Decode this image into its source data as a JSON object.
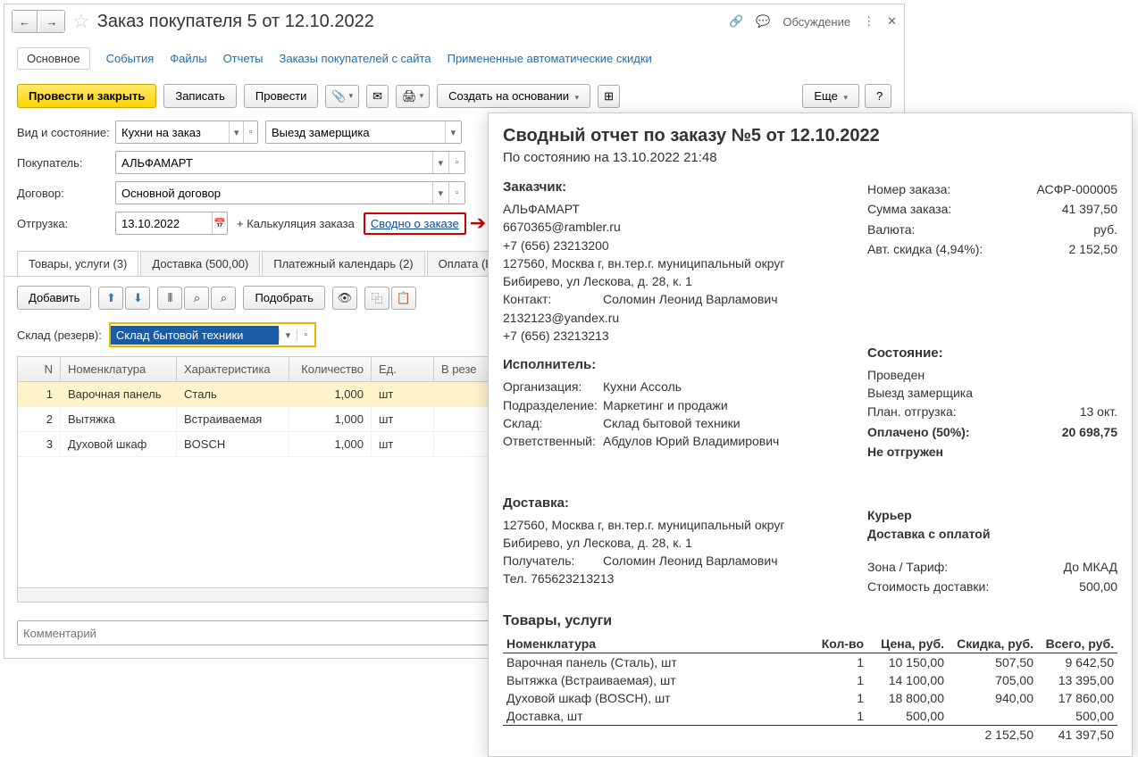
{
  "title": "Заказ покупателя 5 от 12.10.2022",
  "discuss": "Обсуждение",
  "tabs": [
    "Основное",
    "События",
    "Файлы",
    "Отчеты",
    "Заказы покупателей с сайта",
    "Примененные автоматические скидки"
  ],
  "toolbar": {
    "post_close": "Провести и закрыть",
    "save": "Записать",
    "post": "Провести",
    "create_based": "Создать на основании",
    "more": "Еще"
  },
  "form": {
    "type_label": "Вид и состояние:",
    "type_value": "Кухни на заказ",
    "state_value": "Выезд замерщика",
    "buyer_label": "Покупатель:",
    "buyer_value": "АЛЬФАМАРТ",
    "contract_label": "Договор:",
    "contract_value": "Основной договор",
    "ship_label": "Отгрузка:",
    "ship_date": "13.10.2022",
    "calc": "+ Калькуляция заказа",
    "summary": "Сводно о заказе"
  },
  "tabs2": [
    "Товары, услуги (3)",
    "Доставка (500,00)",
    "Платежный календарь (2)",
    "Оплата (Вруч"
  ],
  "tabletb": {
    "add": "Добавить",
    "pick": "Подобрать"
  },
  "wh": {
    "label": "Склад (резерв):",
    "value": "Склад бытовой техники"
  },
  "grid": {
    "head": [
      "N",
      "Номенклатура",
      "Характеристика",
      "Количество",
      "Ед.",
      "В резе"
    ],
    "rows": [
      {
        "n": "1",
        "nom": "Варочная панель",
        "char": "Сталь",
        "qty": "1,000",
        "unit": "шт"
      },
      {
        "n": "2",
        "nom": "Вытяжка",
        "char": "Встраиваемая",
        "qty": "1,000",
        "unit": "шт"
      },
      {
        "n": "3",
        "nom": "Духовой шкаф",
        "char": "BOSCH",
        "qty": "1,000",
        "unit": "шт"
      }
    ]
  },
  "comment_ph": "Комментарий",
  "report": {
    "title": "Сводный отчет по заказу №5 от 12.10.2022",
    "sub": "По состоянию на 13.10.2022 21:48",
    "customer_h": "Заказчик:",
    "customer_name": "АЛЬФАМАРТ",
    "cust_email": "6670365@rambler.ru",
    "cust_phone": "+7 (656) 23213200",
    "cust_addr": "127560, Москва г, вн.тер.г. муниципальный округ Бибирево, ул Лескова, д. 28, к. 1",
    "contact_l": "Контакт:",
    "contact_v": "Соломин Леонид Варламович",
    "contact_email": "2132123@yandex.ru",
    "contact_phone": "+7 (656) 23213213",
    "exec_h": "Исполнитель:",
    "org_l": "Организация:",
    "org_v": "Кухни Ассоль",
    "dept_l": "Подразделение:",
    "dept_v": "Маркетинг и продажи",
    "wh_l": "Склад:",
    "wh_v": "Склад бытовой техники",
    "resp_l": "Ответственный:",
    "resp_v": "Абдулов Юрий Владимирович",
    "right1": [
      {
        "k": "Номер заказа:",
        "v": "АСФР-000005"
      },
      {
        "k": "Сумма заказа:",
        "v": "41 397,50"
      },
      {
        "k": "Валюта:",
        "v": "руб."
      },
      {
        "k": "Авт. скидка (4,94%):",
        "v": "2 152,50"
      }
    ],
    "state_h": "Состояние:",
    "state_lines": [
      "Проведен",
      "Выезд замерщика"
    ],
    "plan_l": "План. отгрузка:",
    "plan_v": "13 окт.",
    "paid_l": "Оплачено (50%):",
    "paid_v": "20 698,75",
    "notshipped": "Не отгружен",
    "deliv_h": "Доставка:",
    "deliv_addr": "127560, Москва г, вн.тер.г. муниципальный округ Бибирево, ул Лескова, д. 28, к. 1",
    "recv_l": "Получатель:",
    "recv_v": "Соломин Леонид Варламович",
    "dtel": "Тел. 765623213213",
    "courier": "Курьер",
    "deliv_pay": "Доставка с оплатой",
    "zone_l": "Зона / Тариф:",
    "zone_v": "До МКАД",
    "dcost_l": "Стоимость доставки:",
    "dcost_v": "500,00",
    "prod_h": "Товары, услуги",
    "thead": [
      "Номенклатура",
      "Кол-во",
      "Цена, руб.",
      "Скидка, руб.",
      "Всего, руб."
    ],
    "items": [
      {
        "n": "Варочная панель (Сталь), шт",
        "q": "1",
        "p": "10 150,00",
        "d": "507,50",
        "t": "9 642,50"
      },
      {
        "n": "Вытяжка (Встраиваемая), шт",
        "q": "1",
        "p": "14 100,00",
        "d": "705,00",
        "t": "13 395,00"
      },
      {
        "n": "Духовой шкаф (BOSCH), шт",
        "q": "1",
        "p": "18 800,00",
        "d": "940,00",
        "t": "17 860,00"
      },
      {
        "n": "Доставка, шт",
        "q": "1",
        "p": "500,00",
        "d": "",
        "t": "500,00"
      }
    ],
    "tot_d": "2 152,50",
    "tot_t": "41 397,50"
  }
}
